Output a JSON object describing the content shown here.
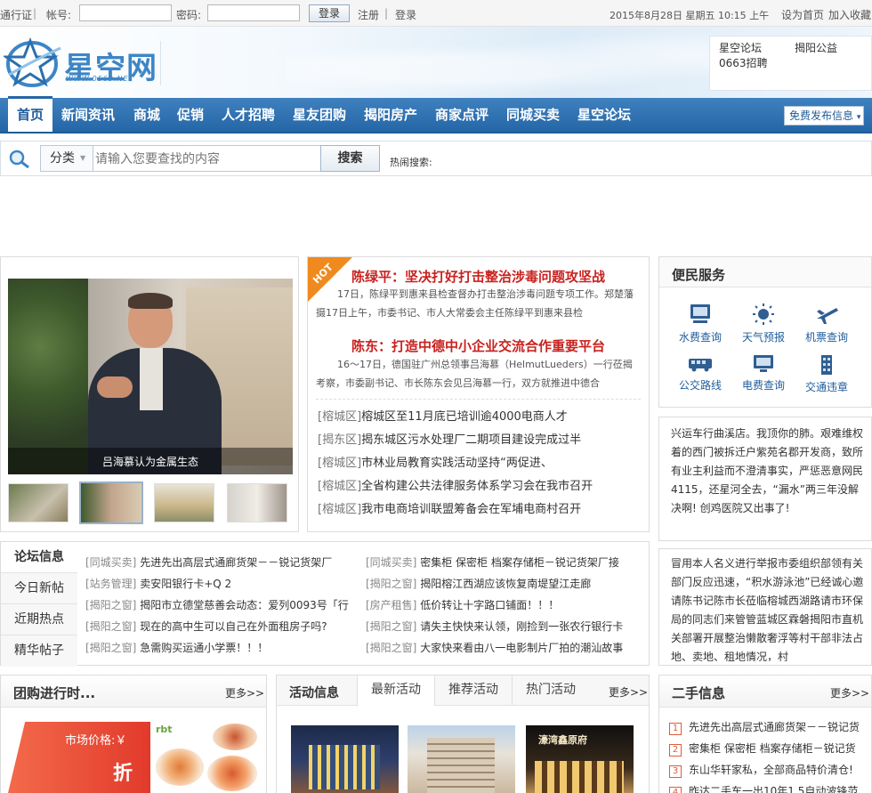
{
  "topbar": {
    "passport": "通行证",
    "account_label": "帐号:",
    "password_label": "密码:",
    "login": "登录",
    "register": "注册",
    "sep": "|",
    "login_link": "登录",
    "date": "2015年8月28日 星期五 10:15 上午",
    "set_home": "设为首页",
    "favorite": "加入收藏"
  },
  "header": {
    "logo_text": "星空网",
    "logo_url": "WWW.0563.NET",
    "quick_links": [
      "星空论坛",
      "揭阳公益",
      "0663招聘"
    ]
  },
  "nav": {
    "items": [
      "首页",
      "新闻资讯",
      "商城",
      "促销",
      "人才招聘",
      "星友团购",
      "揭阳房产",
      "商家点评",
      "同城买卖",
      "星空论坛"
    ],
    "post_button": "免费发布信息"
  },
  "search": {
    "category": "分类",
    "placeholder": "请输入您要查找的内容",
    "button": "搜索",
    "hot_label": "热闹搜索:"
  },
  "slideshow": {
    "caption": "吕海慕认为金属生态"
  },
  "headlines": {
    "hot_badge": "HOT",
    "items": [
      {
        "title": "陈绿平：坚决打好打击整治涉毒问题攻坚战",
        "summary": "17日，陈绿平到惠来县检查督办打击整治涉毒问题专项工作。郑楚藩摄17日上午，市委书记、市人大常委会主任陈绿平到惠来县检"
      },
      {
        "title": "陈东：打造中德中小企业交流合作重要平台",
        "summary": "16～17日，德国驻广州总领事吕海慕（HelmutLueders）一行莅揭考察，市委副书记、市长陈东会见吕海慕一行，双方就推进中德合"
      }
    ],
    "news": [
      {
        "tag": "[榕城区]",
        "text": "榕城区至11月底已培训逾4000电商人才"
      },
      {
        "tag": "[揭东区]",
        "text": "揭东城区污水处理厂二期项目建设完成过半"
      },
      {
        "tag": "[榕城区]",
        "text": "市林业局教育实践活动坚持“两促进、"
      },
      {
        "tag": "[榕城区]",
        "text": "全省构建公共法律服务体系学习会在我市召开"
      },
      {
        "tag": "[榕城区]",
        "text": "我市电商培训联盟筹备会在军埔电商村召开"
      }
    ]
  },
  "services": {
    "title": "便民服务",
    "items": [
      "水费查询",
      "天气预报",
      "机票查询",
      "公交路线",
      "电费查询",
      "交通违章"
    ]
  },
  "notice1": {
    "text": "兴运车行曲溪店。我顶你的肺。艰难维权着的西门被拆迁户紫苑名郡开发商，致所有业主利益而不澄清事实，严惩恶意网民4115，还星河全去，“漏水”两三年没解决啊! 创鸡医院又出事了!"
  },
  "notice2": {
    "text": "冒用本人名义进行举报市委组织部领有关部门反应迅速，“积水游泳池”已经诚心邀请陈书记陈市长莅临榕城西湖路请市环保局的同志们来管管蓝城区霖磐揭阳市直机关部署开展整治懒散奢浮等村干部非法占地、卖地、租地情况，村"
  },
  "forum": {
    "tabs": [
      "论坛信息",
      "今日新帖",
      "近期热点",
      "精华帖子"
    ],
    "rows_left": [
      {
        "tag": "[同城买卖]",
        "text": "先进先出高层式通廊货架－－锐记货架厂"
      },
      {
        "tag": "[站务管理]",
        "text": "卖安阳银行卡+Q 2"
      },
      {
        "tag": "[揭阳之窗]",
        "text": "揭阳市立德堂慈善会动态：爱列0093号「行"
      },
      {
        "tag": "[揭阳之窗]",
        "text": "现在的高中生可以自己在外面租房子吗?"
      },
      {
        "tag": "[揭阳之窗]",
        "text": "急需购买运通小学票！！！"
      }
    ],
    "rows_right": [
      {
        "tag": "[同城买卖]",
        "text": "密集柜 保密柜 档案存储柜－锐记货架厂接"
      },
      {
        "tag": "[揭阳之窗]",
        "text": "揭阳榕江西湖应该恢复南堤望江走廊"
      },
      {
        "tag": "[房产租售]",
        "text": "低价转让十字路口铺面！！！"
      },
      {
        "tag": "[揭阳之窗]",
        "text": "请失主快快来认领，刚捡到一张农行银行卡"
      },
      {
        "tag": "[揭阳之窗]",
        "text": "大家快来看由八一电影制片厂拍的潮汕故事"
      }
    ]
  },
  "group_buy": {
    "title": "团购进行时...",
    "more": "更多>>",
    "price_label": "市场价格:￥",
    "discount": "折",
    "brand": "rbt"
  },
  "activity": {
    "title": "活动信息",
    "tabs": [
      "最新活动",
      "推荐活动",
      "热门活动"
    ],
    "more": "更多>>",
    "sign_text": "濠湾鑫原府"
  },
  "secondhand": {
    "title": "二手信息",
    "more": "更多>>",
    "items": [
      {
        "num": "1",
        "text": "先进先出高层式通廊货架－－锐记货"
      },
      {
        "num": "2",
        "text": "密集柜 保密柜 档案存储柜－锐记货"
      },
      {
        "num": "3",
        "text": "东山华轩家私，全部商品特价清仓!"
      },
      {
        "num": "4",
        "text": "昨达二手车一出10年1.5自动波锋范"
      }
    ]
  }
}
